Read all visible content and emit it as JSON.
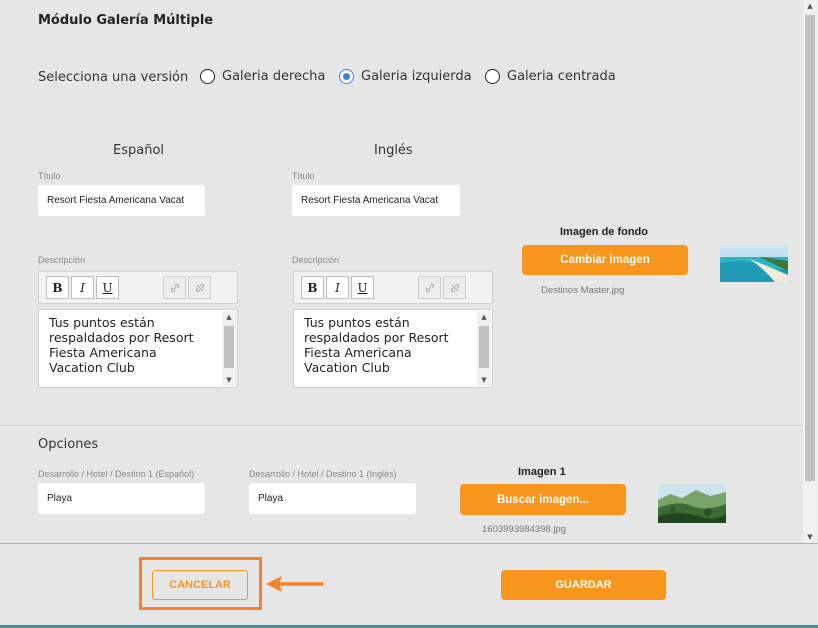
{
  "title": "Módulo Galería Múltiple",
  "version": {
    "label": "Selecciona una versión",
    "options": [
      {
        "label": "Galeria derecha",
        "checked": false
      },
      {
        "label": "Galeria izquierda",
        "checked": true
      },
      {
        "label": "Galeria centrada",
        "checked": false
      }
    ]
  },
  "spanish": {
    "heading": "Español",
    "title_label": "Título",
    "title_value": "Resort Fiesta Americana Vacat",
    "desc_label": "Descripción",
    "desc_value": "Tus puntos están\nrespaldados por Resort\nFiesta Americana\nVacation Club"
  },
  "english": {
    "heading": "Inglés",
    "title_label": "Título",
    "title_value": "Resort Fiesta Americana Vacat",
    "desc_label": "Descripción",
    "desc_value": "Tus puntos están\nrespaldados por Resort\nFiesta Americana\nVacation Club"
  },
  "toolbar": {
    "bold": "B",
    "italic": "I",
    "underline": "U"
  },
  "background_image": {
    "caption": "Imagen de fondo",
    "button": "Cambiar imagen",
    "file": "Destinos Master.jpg"
  },
  "options": {
    "heading": "Opciones",
    "es_label": "Desarrollo / Hotel / Destino 1 (Español)",
    "es_value": "Playa",
    "en_label": "Desarrollo / Hotel / Destino 1 (Inglés)",
    "en_value": "Playa",
    "image_caption": "Imagen 1",
    "image_button": "Buscar imagen...",
    "image_file": "1603993984398.jpg"
  },
  "footer": {
    "cancel": "CANCELAR",
    "save": "GUARDAR"
  },
  "colors": {
    "accent": "#f7951d",
    "radio": "#3b82d8",
    "highlight": "#f5822a"
  }
}
